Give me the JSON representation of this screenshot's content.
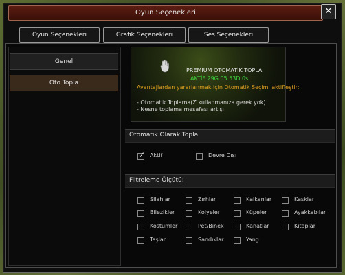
{
  "window": {
    "title": "Oyun Seçenekleri",
    "close_glyph": "✕"
  },
  "tabs": [
    {
      "label": "Oyun Seçenekleri"
    },
    {
      "label": "Grafik Seçenekleri"
    },
    {
      "label": "Ses Seçenekleri"
    }
  ],
  "sidebar": {
    "items": [
      {
        "label": "Genel"
      },
      {
        "label": "Oto Topla"
      }
    ]
  },
  "banner": {
    "title": "PREMIUM OTOMATİK TOPLA",
    "status": "AKTİF 29G 05 53D 0s",
    "desc": "Avantajlardan yararlanmak için Otomatik Seçimi aktifleştir:",
    "bullets": [
      "- Otomatik Toplama(Z kullanmanıza gerek yok)",
      "- Nesne toplama mesafası artışı"
    ]
  },
  "auto_collect": {
    "heading": "Otomatik Olarak Topla",
    "options": [
      {
        "label": "Aktif",
        "checked": true
      },
      {
        "label": "Devre Dışı",
        "checked": false
      }
    ]
  },
  "filter": {
    "heading": "Filtreleme Ölçütü:",
    "items": [
      {
        "label": "Silahlar"
      },
      {
        "label": "Zırhlar"
      },
      {
        "label": "Kalkanlar"
      },
      {
        "label": "Kasklar"
      },
      {
        "label": "Bilezikler"
      },
      {
        "label": "Kolyeler"
      },
      {
        "label": "Küpeler"
      },
      {
        "label": "Ayakkabılar"
      },
      {
        "label": "Kostümler"
      },
      {
        "label": "Pet/Binek"
      },
      {
        "label": "Kanatlar"
      },
      {
        "label": "Kitaplar"
      },
      {
        "label": "Taşlar"
      },
      {
        "label": "Sandıklar"
      },
      {
        "label": "Yang"
      }
    ]
  },
  "colors": {
    "status_green": "#3ecf3e",
    "desc_orange": "#e0a020"
  }
}
